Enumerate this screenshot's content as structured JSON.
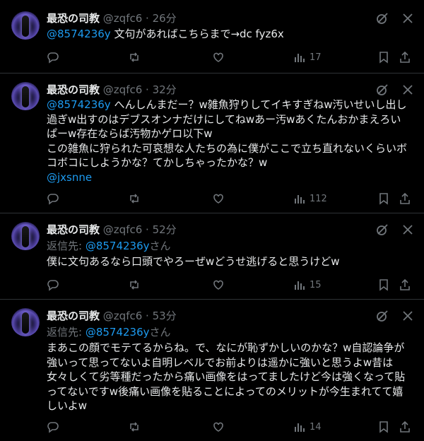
{
  "tweets": [
    {
      "name": "最恐の司教",
      "handle": "@zqfc6 · 26分",
      "mention": "@8574236y",
      "text": " 文句があればこちらまで→dc fyz6x",
      "reply_prefix": "",
      "reply_handle": "",
      "reply_suffix": "",
      "tail_mention": "",
      "views": "17"
    },
    {
      "name": "最恐の司教",
      "handle": "@zqfc6 · 32分",
      "mention": "@8574236y",
      "text": " へんしんまだー？w雑魚狩りしてイキすぎねw汚いせいし出し過ぎw出すのはデブスオンナだけにしてねwあー汚wあくたんおかまえろいぱーw存在ならば汚物かゲロ以下w\nこの雑魚に狩られた可哀想な人たちの為に僕がここで立ち直れないくらいボコボコにしようかな？てかしちゃったかな？w",
      "reply_prefix": "",
      "reply_handle": "",
      "reply_suffix": "",
      "tail_mention": "@jxsnne",
      "views": "112"
    },
    {
      "name": "最恐の司教",
      "handle": "@zqfc6 · 52分",
      "mention": "",
      "text": "僕に文句あるなら口頭でやろーぜwどうせ逃げると思うけどw",
      "reply_prefix": "返信先: ",
      "reply_handle": "@8574236y",
      "reply_suffix": "さん",
      "tail_mention": "",
      "views": "15"
    },
    {
      "name": "最恐の司教",
      "handle": "@zqfc6 · 53分",
      "mention": "",
      "text": "まあこの顔でモテてるからね。で、なにが恥ずかしいのかな？w自認論争が強いって思ってないよ自明レベルでお前よりは遥かに強いと思うよw昔は女々しくて劣等種だったから痛い画像をはってましたけど今は強くなって貼ってないですw後痛い画像を貼ることによってのメリットが今生まれてて嬉しいよw",
      "reply_prefix": "返信先: ",
      "reply_handle": "@8574236y",
      "reply_suffix": "さん",
      "tail_mention": "",
      "views": "14"
    }
  ],
  "icons": [
    "grok-icon",
    "more-icon",
    "reply-icon",
    "retweet-icon",
    "like-icon",
    "views-icon",
    "bookmark-icon",
    "share-icon"
  ],
  "colors": {
    "background": "#000000",
    "text": "#e7e9ea",
    "muted": "#71767b",
    "link": "#1d9bf0",
    "divider": "#2f3336"
  }
}
